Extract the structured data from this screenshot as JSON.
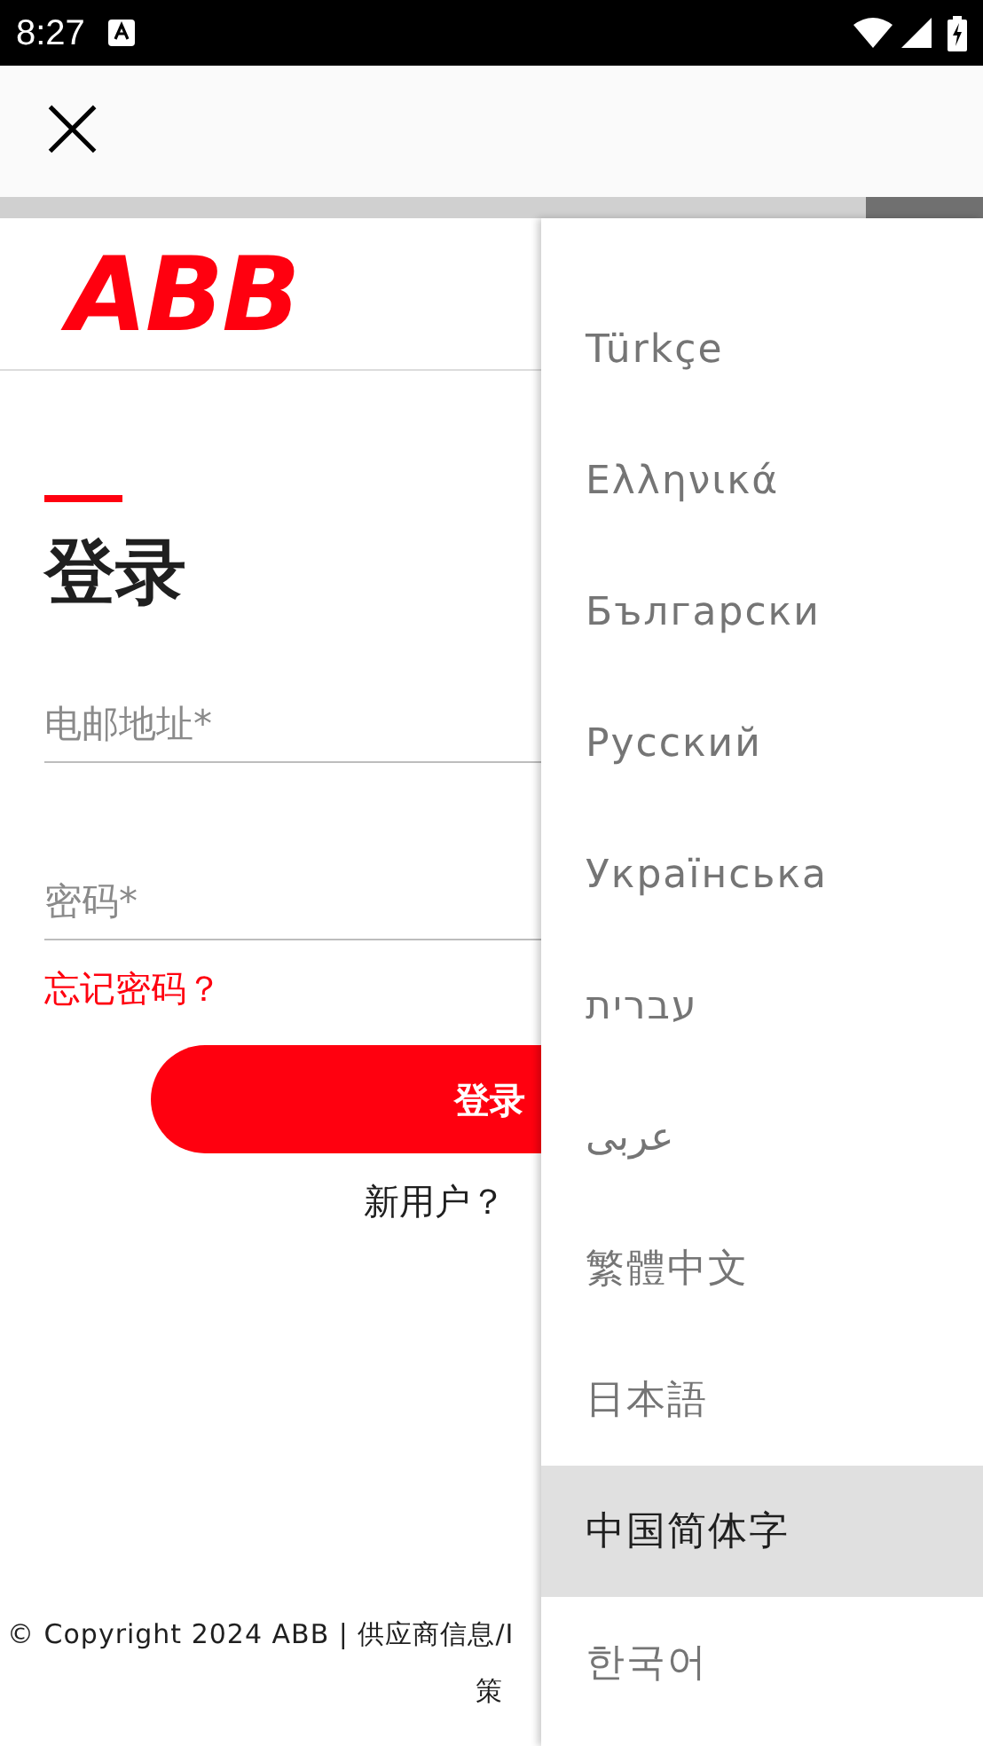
{
  "status_bar": {
    "time": "8:27"
  },
  "toolbar": {
    "close": "×"
  },
  "page": {
    "logo": "ABB",
    "title": "登录",
    "fields": [
      {
        "placeholder": "电邮地址*"
      },
      {
        "placeholder": "密码*"
      }
    ],
    "forgot_link": "忘记密码？",
    "login_button": "登录",
    "new_user_link": "新用户？",
    "footer": [
      "© Copyright 2024 ABB | 供应商信息/I",
      "策"
    ]
  },
  "progress": {
    "level": 0.88
  },
  "language_menu": {
    "items": [
      {
        "label": "Türkçe",
        "selected": false
      },
      {
        "label": "Ελληνικά",
        "selected": false
      },
      {
        "label": "Български",
        "selected": false
      },
      {
        "label": "Русский",
        "selected": false
      },
      {
        "label": "Українська",
        "selected": false
      },
      {
        "label": "עברית",
        "selected": false
      },
      {
        "label": "عربى",
        "selected": false
      },
      {
        "label": "繁體中文",
        "selected": false
      },
      {
        "label": "日本語",
        "selected": false
      },
      {
        "label": "中国简体字",
        "selected": true
      },
      {
        "label": "한국어",
        "selected": false
      }
    ]
  }
}
